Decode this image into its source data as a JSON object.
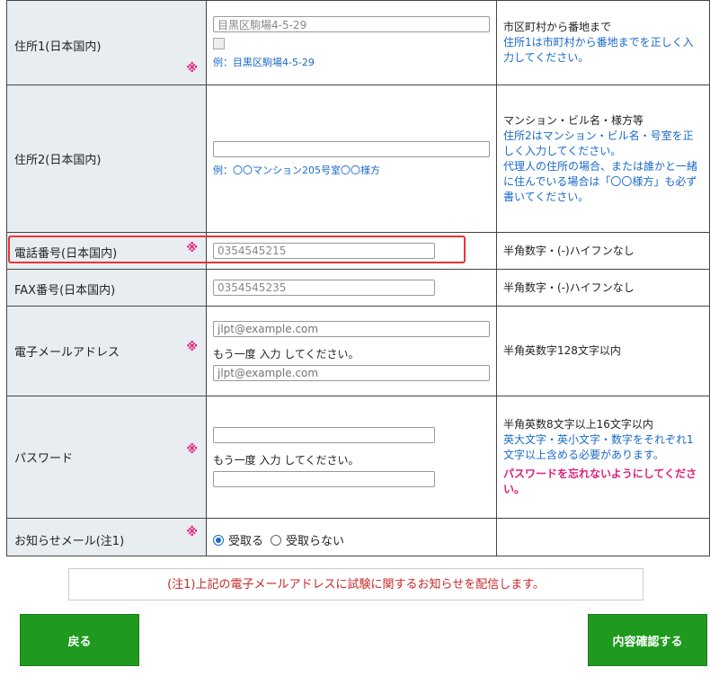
{
  "rows": {
    "address1": {
      "label": "住所1(日本国内)",
      "required_mark": "※",
      "value": "目黒区駒場4-5-29",
      "example": "例：目黒区駒場4-5-29",
      "hint_main": "市区町村から番地まで",
      "hint_blue": "住所1は市町村から番地までを正しく入力してください。"
    },
    "address2": {
      "label": "住所2(日本国内)",
      "value": "",
      "example": "例：〇〇マンション205号室〇〇様方",
      "hint_main": "マンション・ビル名・様方等",
      "hint_blue_1": "住所2はマンション・ビル名・号室を正しく入力してください。",
      "hint_blue_2": "代理人の住所の場合、または誰かと一緒に住んでいる場合は「〇〇様方」も必ず書いてください。"
    },
    "phone": {
      "label": "電話番号(日本国内)",
      "required_mark": "※",
      "value": "0354545215",
      "hint": "半角数字・(-)ハイフンなし"
    },
    "fax": {
      "label": "FAX番号(日本国内)",
      "value": "0354545235",
      "hint": "半角数字・(-)ハイフンなし"
    },
    "email": {
      "label": "電子メールアドレス",
      "required_mark": "※",
      "placeholder": "jlpt@example.com",
      "confirm_text": "もう一度 入力 してください。",
      "confirm_placeholder": "jlpt@example.com",
      "hint": "半角英数字128文字以内"
    },
    "password": {
      "label": "パスワード",
      "required_mark": "※",
      "confirm_text": "もう一度 入力 してください。",
      "hint_main": "半角英数8文字以上16文字以内",
      "hint_blue": "英大文字・英小文字・数字をそれぞれ1文字以上含める必要があります。",
      "hint_pink": "パスワードを忘れないようにしてください。"
    },
    "notify": {
      "label": "お知らせメール(注1)",
      "required_mark": "※",
      "option_receive": "受取る",
      "option_decline": "受取らない",
      "selected": "受取る"
    }
  },
  "notice": "(注1)上記の電子メールアドレスに試験に関するお知らせを配信します。",
  "buttons": {
    "back": "戻る",
    "confirm": "内容確認する"
  },
  "colors": {
    "label_bg": "#e8edf1",
    "required": "#e0207a",
    "link_blue": "#1a6ac9",
    "button_green": "#1f9a1f",
    "highlight": "#ee3333",
    "notice_red": "#c62828"
  }
}
